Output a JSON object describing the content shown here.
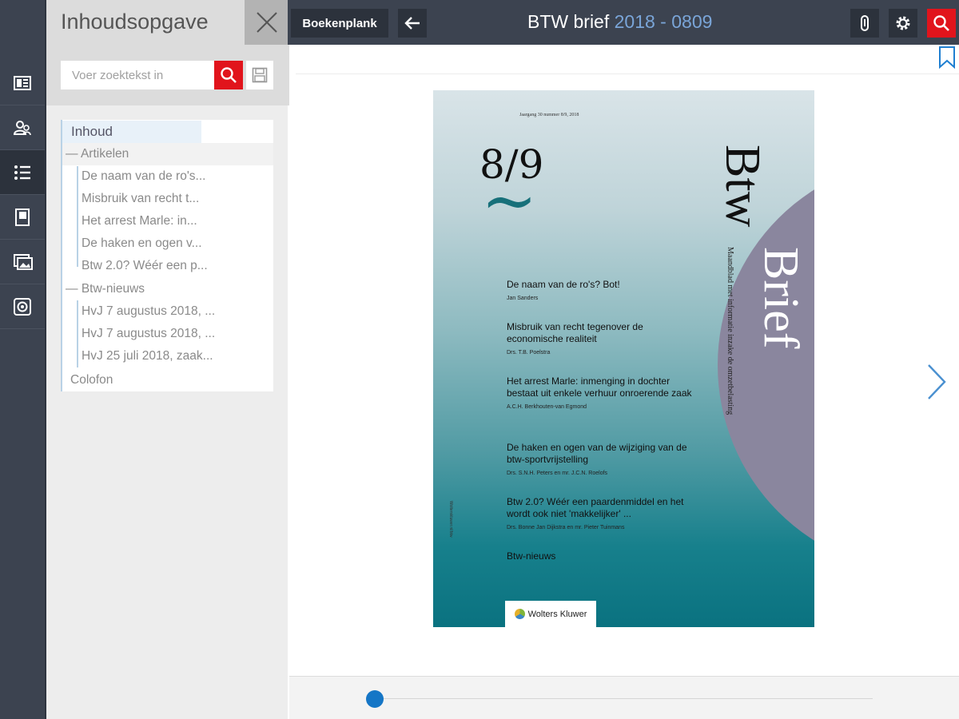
{
  "rail": {
    "items": [
      {
        "icon": "book-cover-icon"
      },
      {
        "icon": "users-icon"
      },
      {
        "icon": "list-icon",
        "active": true
      },
      {
        "icon": "notebook-icon"
      },
      {
        "icon": "image-icon"
      },
      {
        "icon": "settings-circle-icon"
      }
    ]
  },
  "toc": {
    "title": "Inhoudsopgave",
    "search_placeholder": "Voer zoektekst in",
    "tree": {
      "root": "Inhoud",
      "group1": "Artikelen",
      "articles": [
        "De naam van de ro's...",
        "Misbruik van recht t...",
        "Het arrest Marle: in...",
        "De haken en ogen v...",
        "Btw 2.0? Wéér een p..."
      ],
      "group2": "Btw-nieuws",
      "news": [
        "HvJ 7 augustus 2018, ...",
        "HvJ 7 augustus 2018, ...",
        "HvJ 25 juli 2018, zaak..."
      ],
      "colofon": "Colofon"
    }
  },
  "topbar": {
    "shelf_label": "Boekenplank",
    "title_main": "BTW brief",
    "title_issue": "2018 - 0809"
  },
  "cover": {
    "small_top": "Jaargang 30 nummer 8/9, 2018",
    "issue": "8/9",
    "tilde": "~",
    "btw": "Btw",
    "brief": "Brief",
    "subtitle": "Maandblad met informatie inzake de omzetbelasting",
    "spine": "Wolterskluwer.nl/btw",
    "articles": [
      {
        "title": "De naam van de ro's? Bot!",
        "author": "Jan Sanders"
      },
      {
        "title": "Misbruik van recht tegenover de economische realiteit",
        "author": "Drs. T.B. Poelstra"
      },
      {
        "title": "Het arrest Marle: inmenging in dochter bestaat uit enkele verhuur onroerende zaak",
        "author": "A.C.H. Berkhouten-van Egmond"
      },
      {
        "title": "De haken en ogen van de wijziging van de btw-sportvrijstelling",
        "author": "Drs. S.N.H. Peters en mr. J.C.N. Roelofs"
      },
      {
        "title": "Btw 2.0? Wéér een paardenmiddel en het wordt ook niet 'makkelijker' ...",
        "author": "Drs. Bonne Jan Dijkstra en mr. Pieter Tuinmans"
      }
    ],
    "news": "Btw-nieuws",
    "publisher": "Wolters Kluwer"
  },
  "slider": {
    "position": 0.0
  }
}
